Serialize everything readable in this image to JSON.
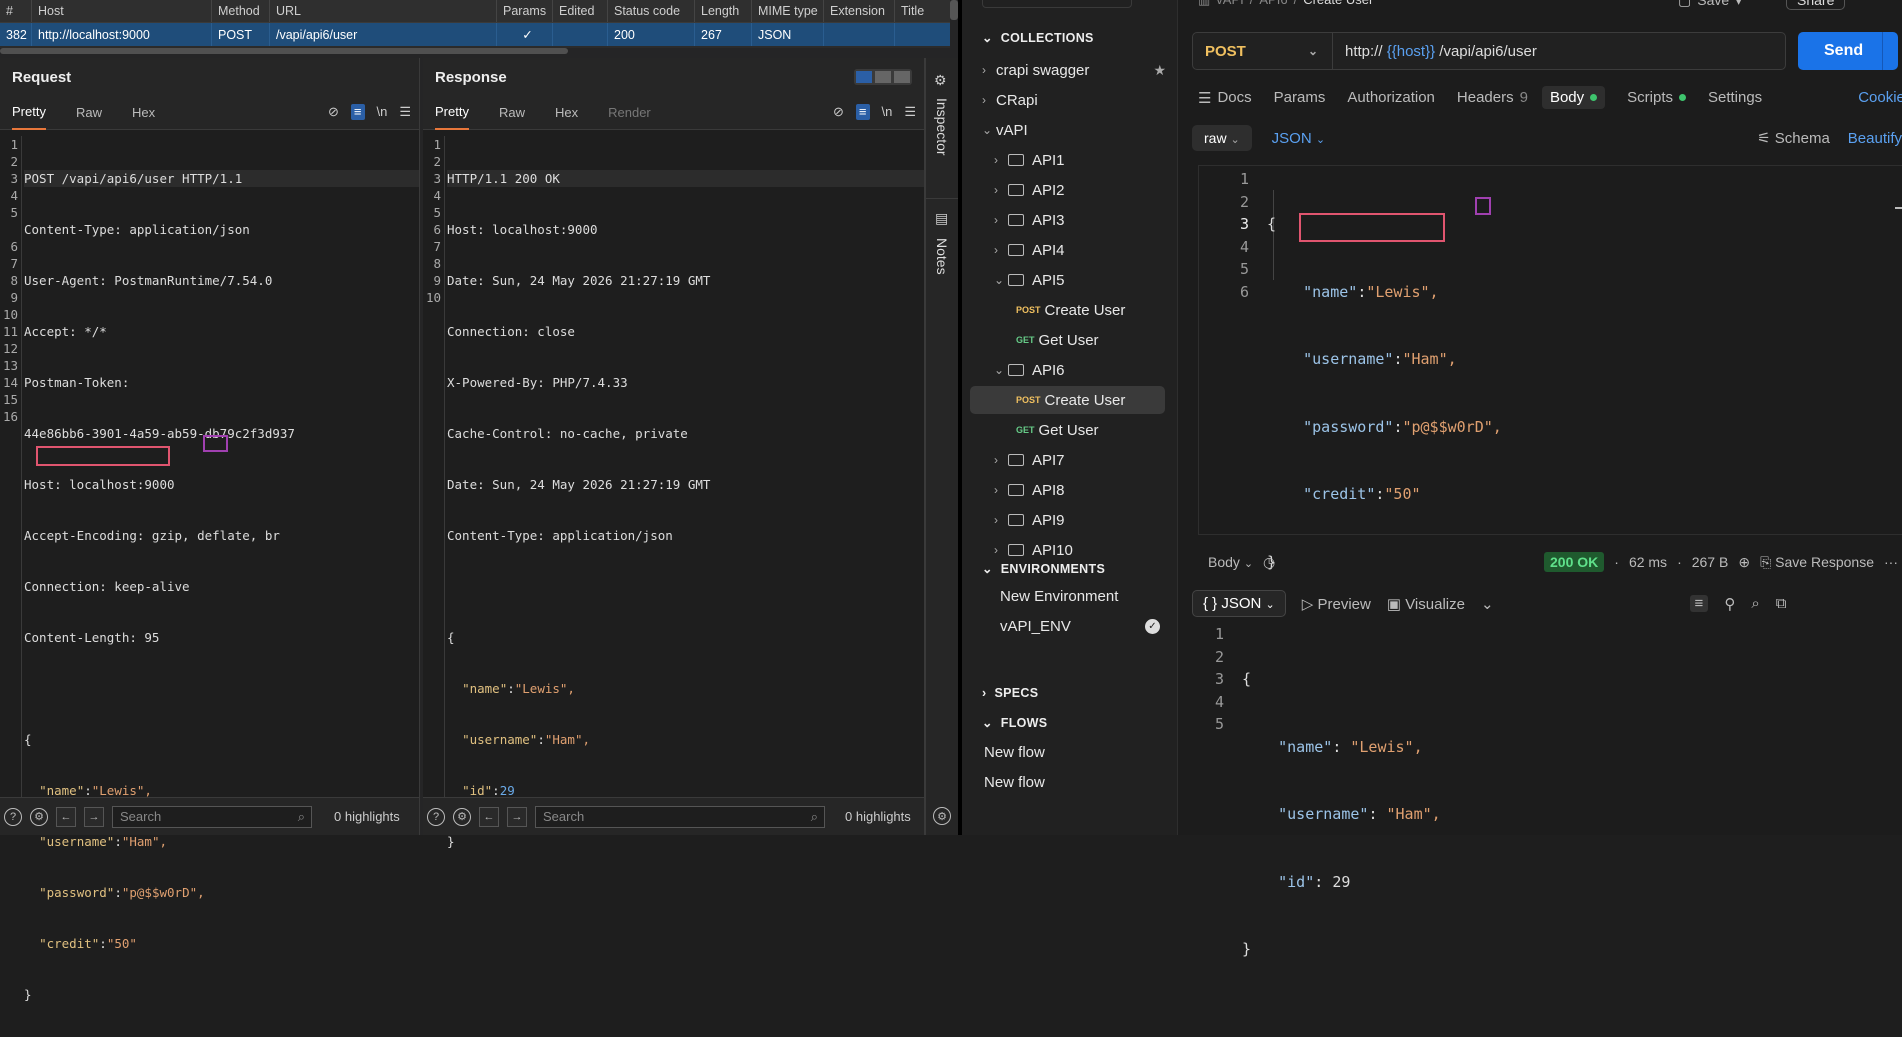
{
  "burp": {
    "history": {
      "columns": [
        "#",
        "Host",
        "Method",
        "URL",
        "Params",
        "Edited",
        "Status code",
        "Length",
        "MIME type",
        "Extension",
        "Title"
      ],
      "row": {
        "id": "382",
        "host": "http://localhost:9000",
        "method": "POST",
        "url": "/vapi/api6/user",
        "params": "✓",
        "edited": "",
        "status": "200",
        "length": "267",
        "mime": "JSON",
        "extension": "",
        "title": ""
      }
    },
    "request": {
      "title": "Request",
      "tabs": [
        "Pretty",
        "Raw",
        "Hex"
      ],
      "line_numbers": [
        "1",
        "2",
        "3",
        "4",
        "5",
        "",
        "6",
        "7",
        "8",
        "9",
        "10",
        "11",
        "12",
        "13",
        "14",
        "15",
        "16"
      ],
      "lines": [
        "POST /vapi/api6/user HTTP/1.1",
        "Content-Type: application/json",
        "User-Agent: PostmanRuntime/7.54.0",
        "Accept: */*",
        "Postman-Token:",
        "44e86bb6-3901-4a59-ab59-db79c2f3d937",
        "Host: localhost:9000",
        "Accept-Encoding: gzip, deflate, br",
        "Connection: keep-alive",
        "Content-Length: 95",
        "",
        "{"
      ],
      "json": [
        {
          "k": "\"name\"",
          "v": "\"Lewis\","
        },
        {
          "k": "\"username\"",
          "v": "\"Ham\","
        },
        {
          "k": "\"password\"",
          "v": "\"p@$$w0rD\","
        },
        {
          "k": "\"credit\"",
          "v": "\"50\""
        }
      ],
      "close": "}",
      "search_placeholder": "Search",
      "highlights": "0 highlights"
    },
    "response": {
      "title": "Response",
      "tabs": [
        "Pretty",
        "Raw",
        "Hex",
        "Render"
      ],
      "line_numbers": [
        "1",
        "2",
        "3",
        "4",
        "5",
        "6",
        "7",
        "8",
        "9",
        "10"
      ],
      "lines": [
        "HTTP/1.1 200 OK",
        "Host: localhost:9000",
        "Date: Sun, 24 May 2026 21:27:19 GMT",
        "Connection: close",
        "X-Powered-By: PHP/7.4.33",
        "Cache-Control: no-cache, private",
        "Date: Sun, 24 May 2026 21:27:19 GMT",
        "Content-Type: application/json",
        "",
        "{"
      ],
      "json": [
        {
          "k": "\"name\"",
          "v": "\"Lewis\","
        },
        {
          "k": "\"username\"",
          "v": "\"Ham\","
        },
        {
          "k": "\"id\"",
          "v": "29"
        }
      ],
      "close": "}",
      "search_placeholder": "Search",
      "highlights": "0 highlights"
    },
    "side_tabs": [
      "Inspector",
      "Notes"
    ],
    "tool_ln": "\\n"
  },
  "postman": {
    "breadcrumb": [
      "vAPI",
      "API6",
      "Create User"
    ],
    "top_buttons": {
      "save": "Save",
      "share": "Share"
    },
    "collections_label": "COLLECTIONS",
    "tree": [
      {
        "label": "crapi swagger",
        "type": "collection"
      },
      {
        "label": "CRapi",
        "type": "collection"
      },
      {
        "label": "vAPI",
        "type": "collection"
      },
      {
        "label": "API1",
        "type": "folder"
      },
      {
        "label": "API2",
        "type": "folder"
      },
      {
        "label": "API3",
        "type": "folder"
      },
      {
        "label": "API4",
        "type": "folder"
      },
      {
        "label": "API5",
        "type": "folder"
      },
      {
        "label": "Create User",
        "type": "request",
        "method": "POST"
      },
      {
        "label": "Get User",
        "type": "request",
        "method": "GET"
      },
      {
        "label": "API6",
        "type": "folder"
      },
      {
        "label": "Create User",
        "type": "request",
        "method": "POST"
      },
      {
        "label": "Get User",
        "type": "request",
        "method": "GET"
      },
      {
        "label": "API7",
        "type": "folder"
      },
      {
        "label": "API8",
        "type": "folder"
      },
      {
        "label": "API9",
        "type": "folder"
      },
      {
        "label": "API10",
        "type": "folder"
      }
    ],
    "environments_label": "ENVIRONMENTS",
    "environments": [
      "New Environment",
      "vAPI_ENV"
    ],
    "specs_label": "SPECS",
    "flows_label": "FLOWS",
    "flows": [
      "New flow",
      "New flow"
    ],
    "request": {
      "method": "POST",
      "url_prefix": "http://",
      "url_var": "{{host}}",
      "url_path": "/vapi/api6/user",
      "send": "Send",
      "tabs": [
        "Docs",
        "Params",
        "Authorization",
        "Headers",
        "Body",
        "Scripts",
        "Settings",
        "Cookies"
      ],
      "headers_count": "9",
      "body_mode": "raw",
      "body_type": "JSON",
      "schema": "Schema",
      "beautify": "Beautify",
      "body_lines": [
        "1",
        "2",
        "3",
        "4",
        "5",
        "6"
      ],
      "body": [
        {
          "k": "\"name\"",
          "v": "\"Lewis\","
        },
        {
          "k": "\"username\"",
          "v": "\"Ham\","
        },
        {
          "k": "\"password\"",
          "v": "\"p@$$w0rD\","
        },
        {
          "k": "\"credit\"",
          "v": "\"50\""
        }
      ]
    },
    "response": {
      "body_label": "Body",
      "status": "200 OK",
      "time": "62 ms",
      "size": "267 B",
      "save_response": "Save Response",
      "view_type": "JSON",
      "preview": "Preview",
      "visualize": "Visualize",
      "lines": [
        "1",
        "2",
        "3",
        "4",
        "5"
      ],
      "body": [
        {
          "k": "\"name\"",
          "v": "\"Lewis\","
        },
        {
          "k": "\"username\"",
          "v": "\"Ham\","
        },
        {
          "k": "\"id\"",
          "v": "29"
        }
      ]
    }
  },
  "colors": {
    "accent": "#1a73e8",
    "burp_select": "#1f4d7a",
    "highlight_red": "#e0556f",
    "highlight_purple": "#a040b0",
    "status_ok": "#5fe08a"
  }
}
